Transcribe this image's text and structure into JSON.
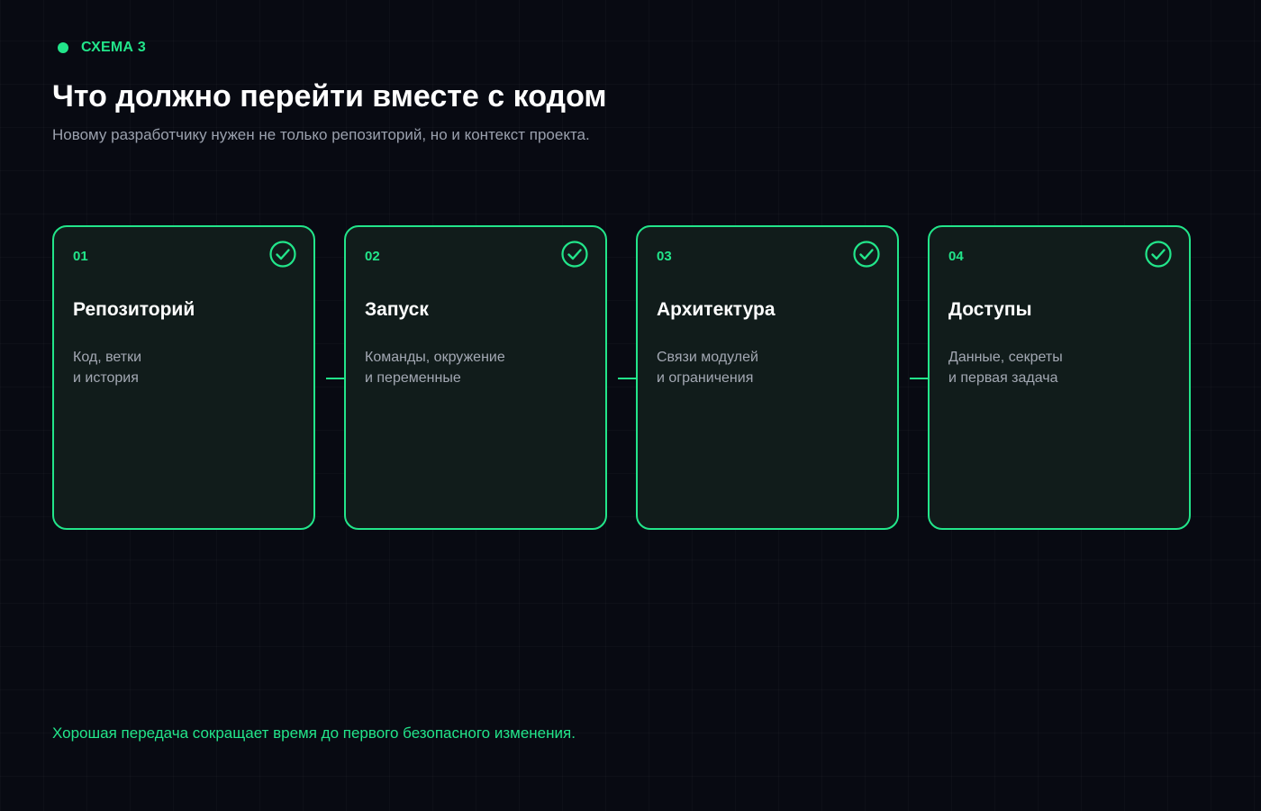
{
  "header": {
    "eyebrow": "СХЕМА 3",
    "title": "Что должно перейти вместе с кодом",
    "subtitle": "Новому разработчику нужен не только репозиторий, но и контекст проекта."
  },
  "steps": [
    {
      "number": "01",
      "title": "Репозиторий",
      "desc_line1": "Код, ветки",
      "desc_line2": "и история",
      "status_icon": "check-circle-icon"
    },
    {
      "number": "02",
      "title": "Запуск",
      "desc_line1": "Команды, окружение",
      "desc_line2": "и переменные",
      "status_icon": "check-circle-icon"
    },
    {
      "number": "03",
      "title": "Архитектура",
      "desc_line1": "Связи модулей",
      "desc_line2": "и ограничения",
      "status_icon": "check-circle-icon"
    },
    {
      "number": "04",
      "title": "Доступы",
      "desc_line1": "Данные, секреты",
      "desc_line2": "и первая задача",
      "status_icon": "check-circle-icon"
    }
  ],
  "footer": {
    "note": "Хорошая передача сокращает время до первого безопасного изменения."
  },
  "colors": {
    "accent": "#22e58a",
    "background": "#080a12",
    "card_background": "#111c1b",
    "muted_text": "#9aa0ad"
  }
}
